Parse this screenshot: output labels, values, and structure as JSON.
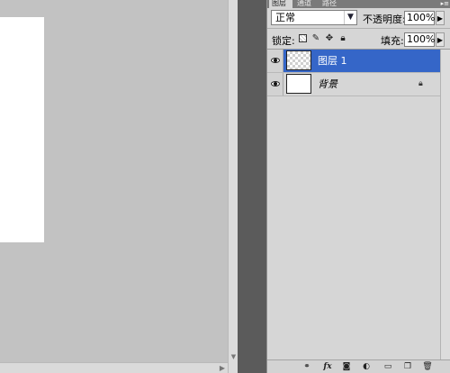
{
  "tabs": [
    {
      "label": "图层",
      "active": true
    },
    {
      "label": "通道",
      "active": false
    },
    {
      "label": "路径",
      "active": false
    }
  ],
  "blend_mode": {
    "value": "正常"
  },
  "opacity": {
    "label": "不透明度:",
    "value": "100%"
  },
  "lock": {
    "label": "锁定:"
  },
  "fill": {
    "label": "填充:",
    "value": "100%"
  },
  "layers": [
    {
      "name": "图层 1",
      "selected": true,
      "visible": true,
      "thumbnail": "transparent"
    },
    {
      "name": "背景",
      "selected": false,
      "visible": true,
      "thumbnail": "white",
      "locked": true
    }
  ],
  "icons": {
    "eye": "eye-icon",
    "lock_transparent": "lock-transparent-pixels-icon",
    "lock_image": "brush-icon",
    "lock_position": "move-icon",
    "lock_all": "lock-icon",
    "layer_lock": "lock-icon",
    "link": "link-icon",
    "fx": "fx-icon",
    "mask": "mask-icon",
    "adjustment": "adjustment-icon",
    "group": "folder-icon",
    "new_layer": "new-layer-icon",
    "trash": "trash-icon"
  },
  "toolbar": {
    "fx_label": "fx"
  },
  "colors": {
    "selection": "#3566c8",
    "panel_bg": "#d6d6d6",
    "canvas_bg": "#c2c2c2"
  }
}
